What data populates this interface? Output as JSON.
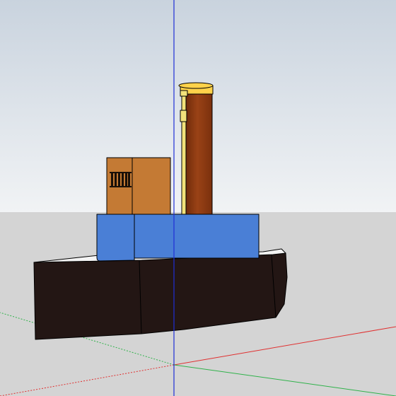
{
  "viewport": {
    "sky_top_color": "#c9d3de",
    "sky_bottom_color": "#f1f3f5",
    "ground_color": "#d4d4d4"
  },
  "axes": {
    "blue_axis_color": "#1f2fd6",
    "red_axis_color": "#e03030",
    "green_axis_color": "#2fb24a"
  },
  "model": {
    "name": "tugboat",
    "hull_color": "#231614",
    "deck_rim_color": "#f3f3f3",
    "cabin_color": "#4a7fd6",
    "wheelhouse_color": "#c47a34",
    "window_color": "#1a1008",
    "funnel_color": "#8b3510",
    "funnel_cap_color": "#ffd24a",
    "pipe_color": "#f2e27a",
    "edge_color": "#000000"
  }
}
